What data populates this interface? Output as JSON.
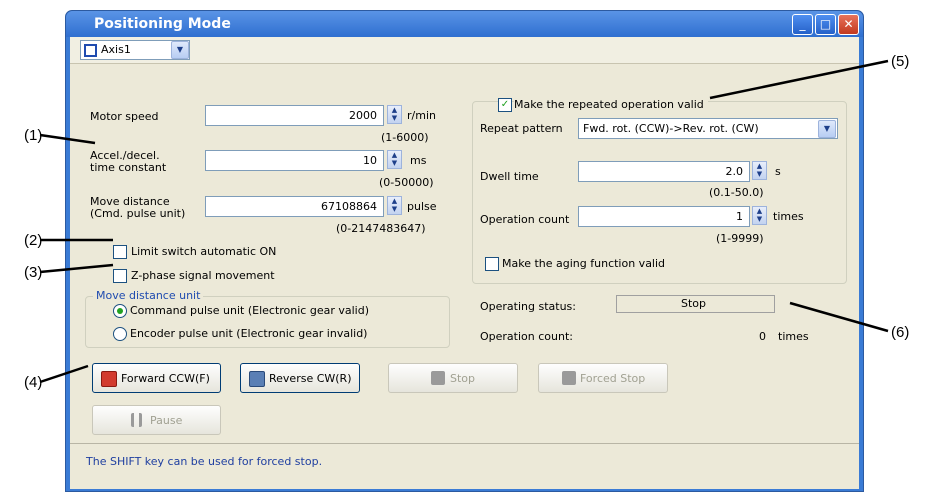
{
  "window": {
    "title": "Positioning Mode"
  },
  "toolbar": {
    "axis": "Axis1"
  },
  "left": {
    "motor_speed": {
      "label": "Motor speed",
      "value": "2000",
      "unit": "r/min",
      "range": "(1-6000)"
    },
    "accel": {
      "label1": "Accel./decel.",
      "label2": "time constant",
      "value": "10",
      "unit": "ms",
      "range": "(0-50000)"
    },
    "move": {
      "label1": "Move distance",
      "label2": "(Cmd. pulse unit)",
      "value": "67108864",
      "unit": "pulse",
      "range": "(0-2147483647)"
    },
    "limit_switch": "Limit switch automatic ON",
    "zphase": "Z-phase signal movement",
    "unit_group": {
      "title": "Move distance unit",
      "option1": "Command pulse unit (Electronic gear valid)",
      "option2": "Encoder pulse unit (Electronic gear invalid)"
    }
  },
  "right": {
    "repeat_valid": "Make the repeated operation valid",
    "repeat_pattern": {
      "label": "Repeat pattern",
      "value": "Fwd. rot. (CCW)->Rev. rot. (CW)"
    },
    "dwell": {
      "label": "Dwell time",
      "value": "2.0",
      "unit": "s",
      "range": "(0.1-50.0)"
    },
    "opcount": {
      "label": "Operation count",
      "value": "1",
      "unit": "times",
      "range": "(1-9999)"
    },
    "aging": "Make the aging function valid",
    "op_status": {
      "label": "Operating status:",
      "value": "Stop"
    },
    "op_count_disp": {
      "label": "Operation count:",
      "value": "0",
      "unit": "times"
    }
  },
  "buttons": {
    "forward": "Forward CCW(F)",
    "reverse": "Reverse CW(R)",
    "stop": "Stop",
    "forced_stop": "Forced Stop",
    "pause": "Pause"
  },
  "footer": {
    "hint": "The SHIFT key can be used for forced stop."
  },
  "callouts": [
    "(1)",
    "(2)",
    "(3)",
    "(4)",
    "(5)",
    "(6)"
  ]
}
